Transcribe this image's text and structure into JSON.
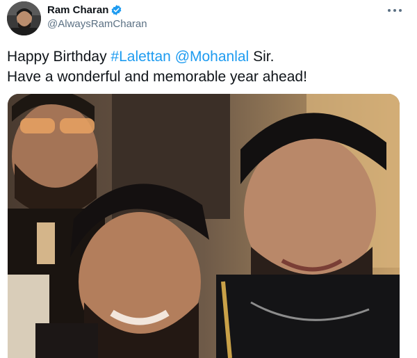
{
  "author": {
    "name": "Ram Charan",
    "handle": "@AlwaysRamCharan",
    "verified": true,
    "avatar_icon": "profile-avatar"
  },
  "tweet": {
    "line1_prefix": "Happy Birthday ",
    "hashtag": "#Lalettan",
    "mention": "@Mohanlal",
    "line1_suffix": " Sir.",
    "line2": "Have a wonderful and memorable year ahead!"
  },
  "media": {
    "description_icon": "photo-of-three-men"
  },
  "colors": {
    "link": "#1d9bf0",
    "verified": "#1d9bf0",
    "handle": "#5b7083"
  },
  "icons": {
    "verified": "verified-badge-icon",
    "more": "more-options-icon"
  }
}
